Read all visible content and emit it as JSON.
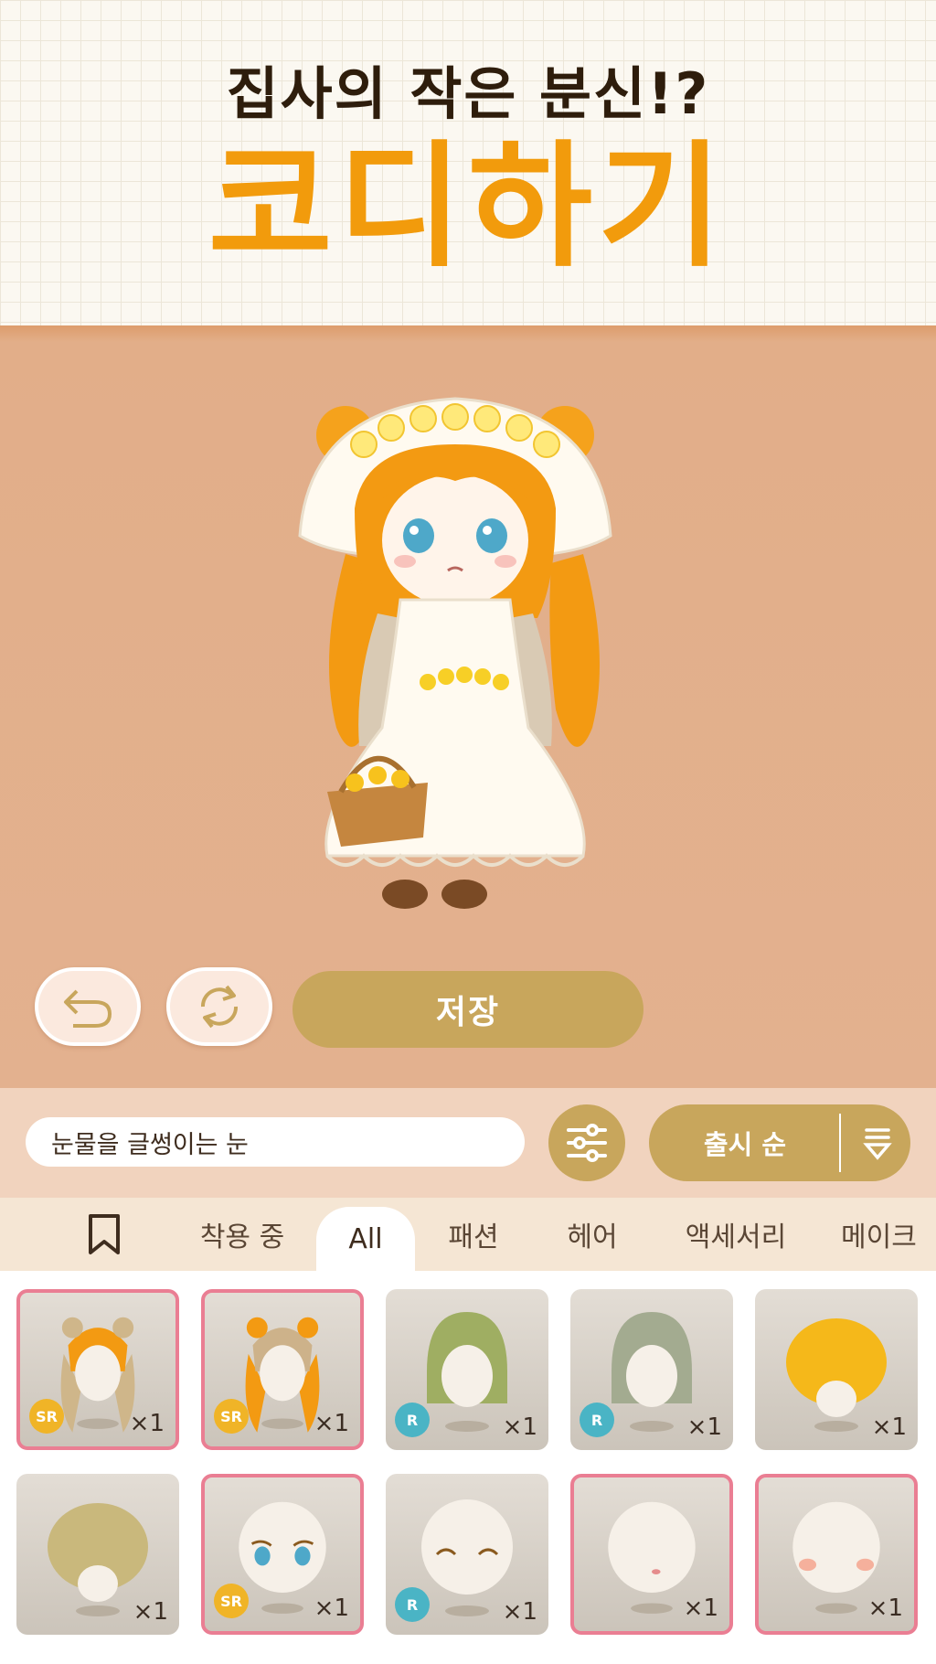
{
  "header": {
    "subtitle": "집사의 작은 분신!?",
    "title": "코디하기"
  },
  "stage": {
    "save_label": "저장",
    "undo_icon": "undo-icon",
    "reset_icon": "rotate-icon"
  },
  "search": {
    "value": "눈물을 글썽이는 눈"
  },
  "sort": {
    "label": "출시 순"
  },
  "tabs": [
    {
      "label": "착용 중"
    },
    {
      "label": "All"
    },
    {
      "label": "패션"
    },
    {
      "label": "헤어"
    },
    {
      "label": "액세서리"
    },
    {
      "label": "메이크"
    }
  ],
  "active_tab": "All",
  "items": [
    {
      "kind": "hair-orange-twintails",
      "rarity": "SR",
      "qty": "×1",
      "selected": true
    },
    {
      "kind": "hair-blonde-twintails",
      "rarity": "SR",
      "qty": "×1",
      "selected": true
    },
    {
      "kind": "hair-green-bob",
      "rarity": "R",
      "qty": "×1",
      "selected": false
    },
    {
      "kind": "hair-sage-bob",
      "rarity": "R",
      "qty": "×1",
      "selected": false
    },
    {
      "kind": "hair-yellow-afro",
      "rarity": "",
      "qty": "×1",
      "selected": false
    },
    {
      "kind": "hair-khaki-afro",
      "rarity": "",
      "qty": "×1",
      "selected": false
    },
    {
      "kind": "eyes-teary",
      "rarity": "SR",
      "qty": "×1",
      "selected": true
    },
    {
      "kind": "eyes-closed-smile",
      "rarity": "R",
      "qty": "×1",
      "selected": false
    },
    {
      "kind": "mouth-small-pink",
      "rarity": "",
      "qty": "×1",
      "selected": true
    },
    {
      "kind": "cheek-blush",
      "rarity": "",
      "qty": "×1",
      "selected": true
    }
  ],
  "colors": {
    "accent_orange": "#f29b0c",
    "gold_button": "#c8a65c",
    "stage_bg": "#e3b18f",
    "selected_border": "#ea7e93",
    "sr_badge": "#f0b427",
    "r_badge": "#4ab4c5"
  }
}
